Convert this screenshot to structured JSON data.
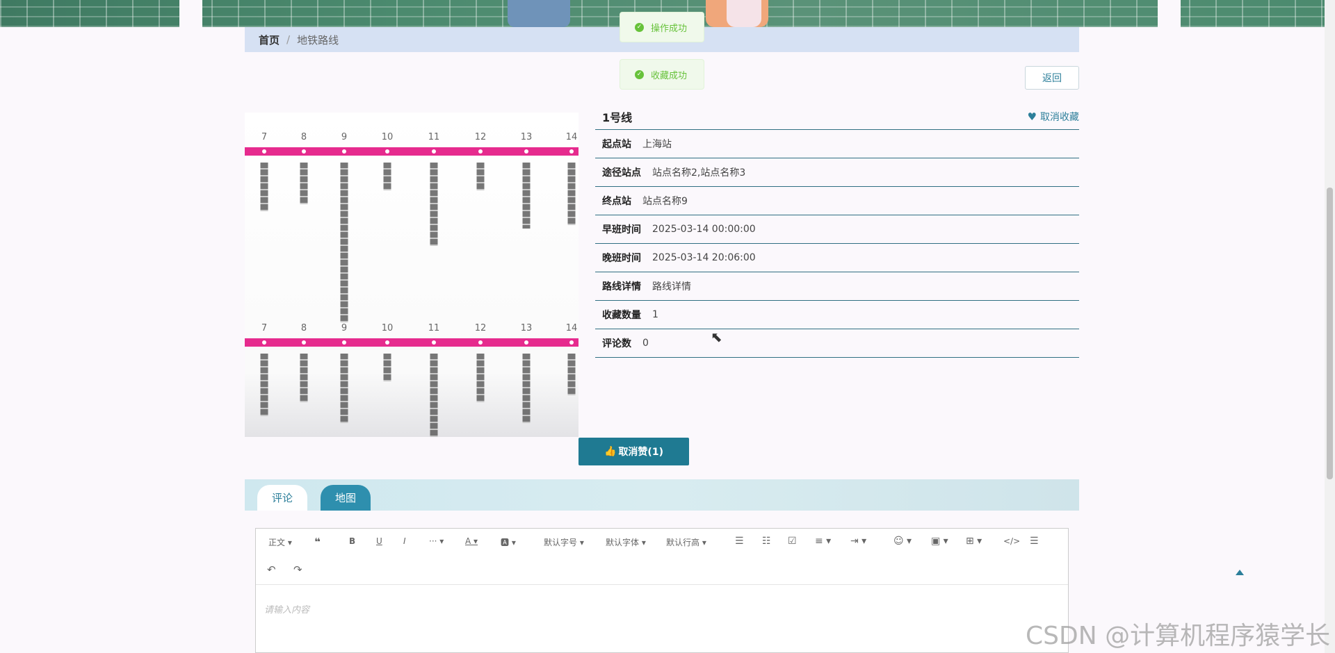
{
  "breadcrumb": {
    "home": "首页",
    "separator": "/",
    "current": "地铁路线"
  },
  "toasts": [
    "操作成功",
    "收藏成功"
  ],
  "back_label": "返回",
  "line": {
    "name": "1号线",
    "favorite_label": "取消收藏",
    "fields": [
      {
        "label": "起点站",
        "value": "上海站"
      },
      {
        "label": "途径站点",
        "value": "站点名称2,站点名称3"
      },
      {
        "label": "终点站",
        "value": "站点名称9"
      },
      {
        "label": "早班时间",
        "value": "2025-03-14 00:00:00"
      },
      {
        "label": "晚班时间",
        "value": "2025-03-14 20:06:00"
      },
      {
        "label": "路线详情",
        "value": "路线详情"
      },
      {
        "label": "收藏数量",
        "value": "1"
      },
      {
        "label": "评论数",
        "value": "0"
      }
    ]
  },
  "metro_image": {
    "numbers": [
      "7",
      "8",
      "9",
      "10",
      "11",
      "12",
      "13",
      "14"
    ]
  },
  "like_label": "取消赞(1)",
  "tabs": {
    "comment": "评论",
    "map": "地图"
  },
  "editor": {
    "toolbar": {
      "paragraph": "正文",
      "font_size": "默认字号",
      "font_family": "默认字体",
      "line_height": "默认行高"
    },
    "placeholder": "请输入内容"
  },
  "watermark": "CSDN @计算机程序猿学长",
  "colors": {
    "accent": "#1f7a92",
    "success": "#67c23a",
    "metro_line": "#e62b8e"
  }
}
